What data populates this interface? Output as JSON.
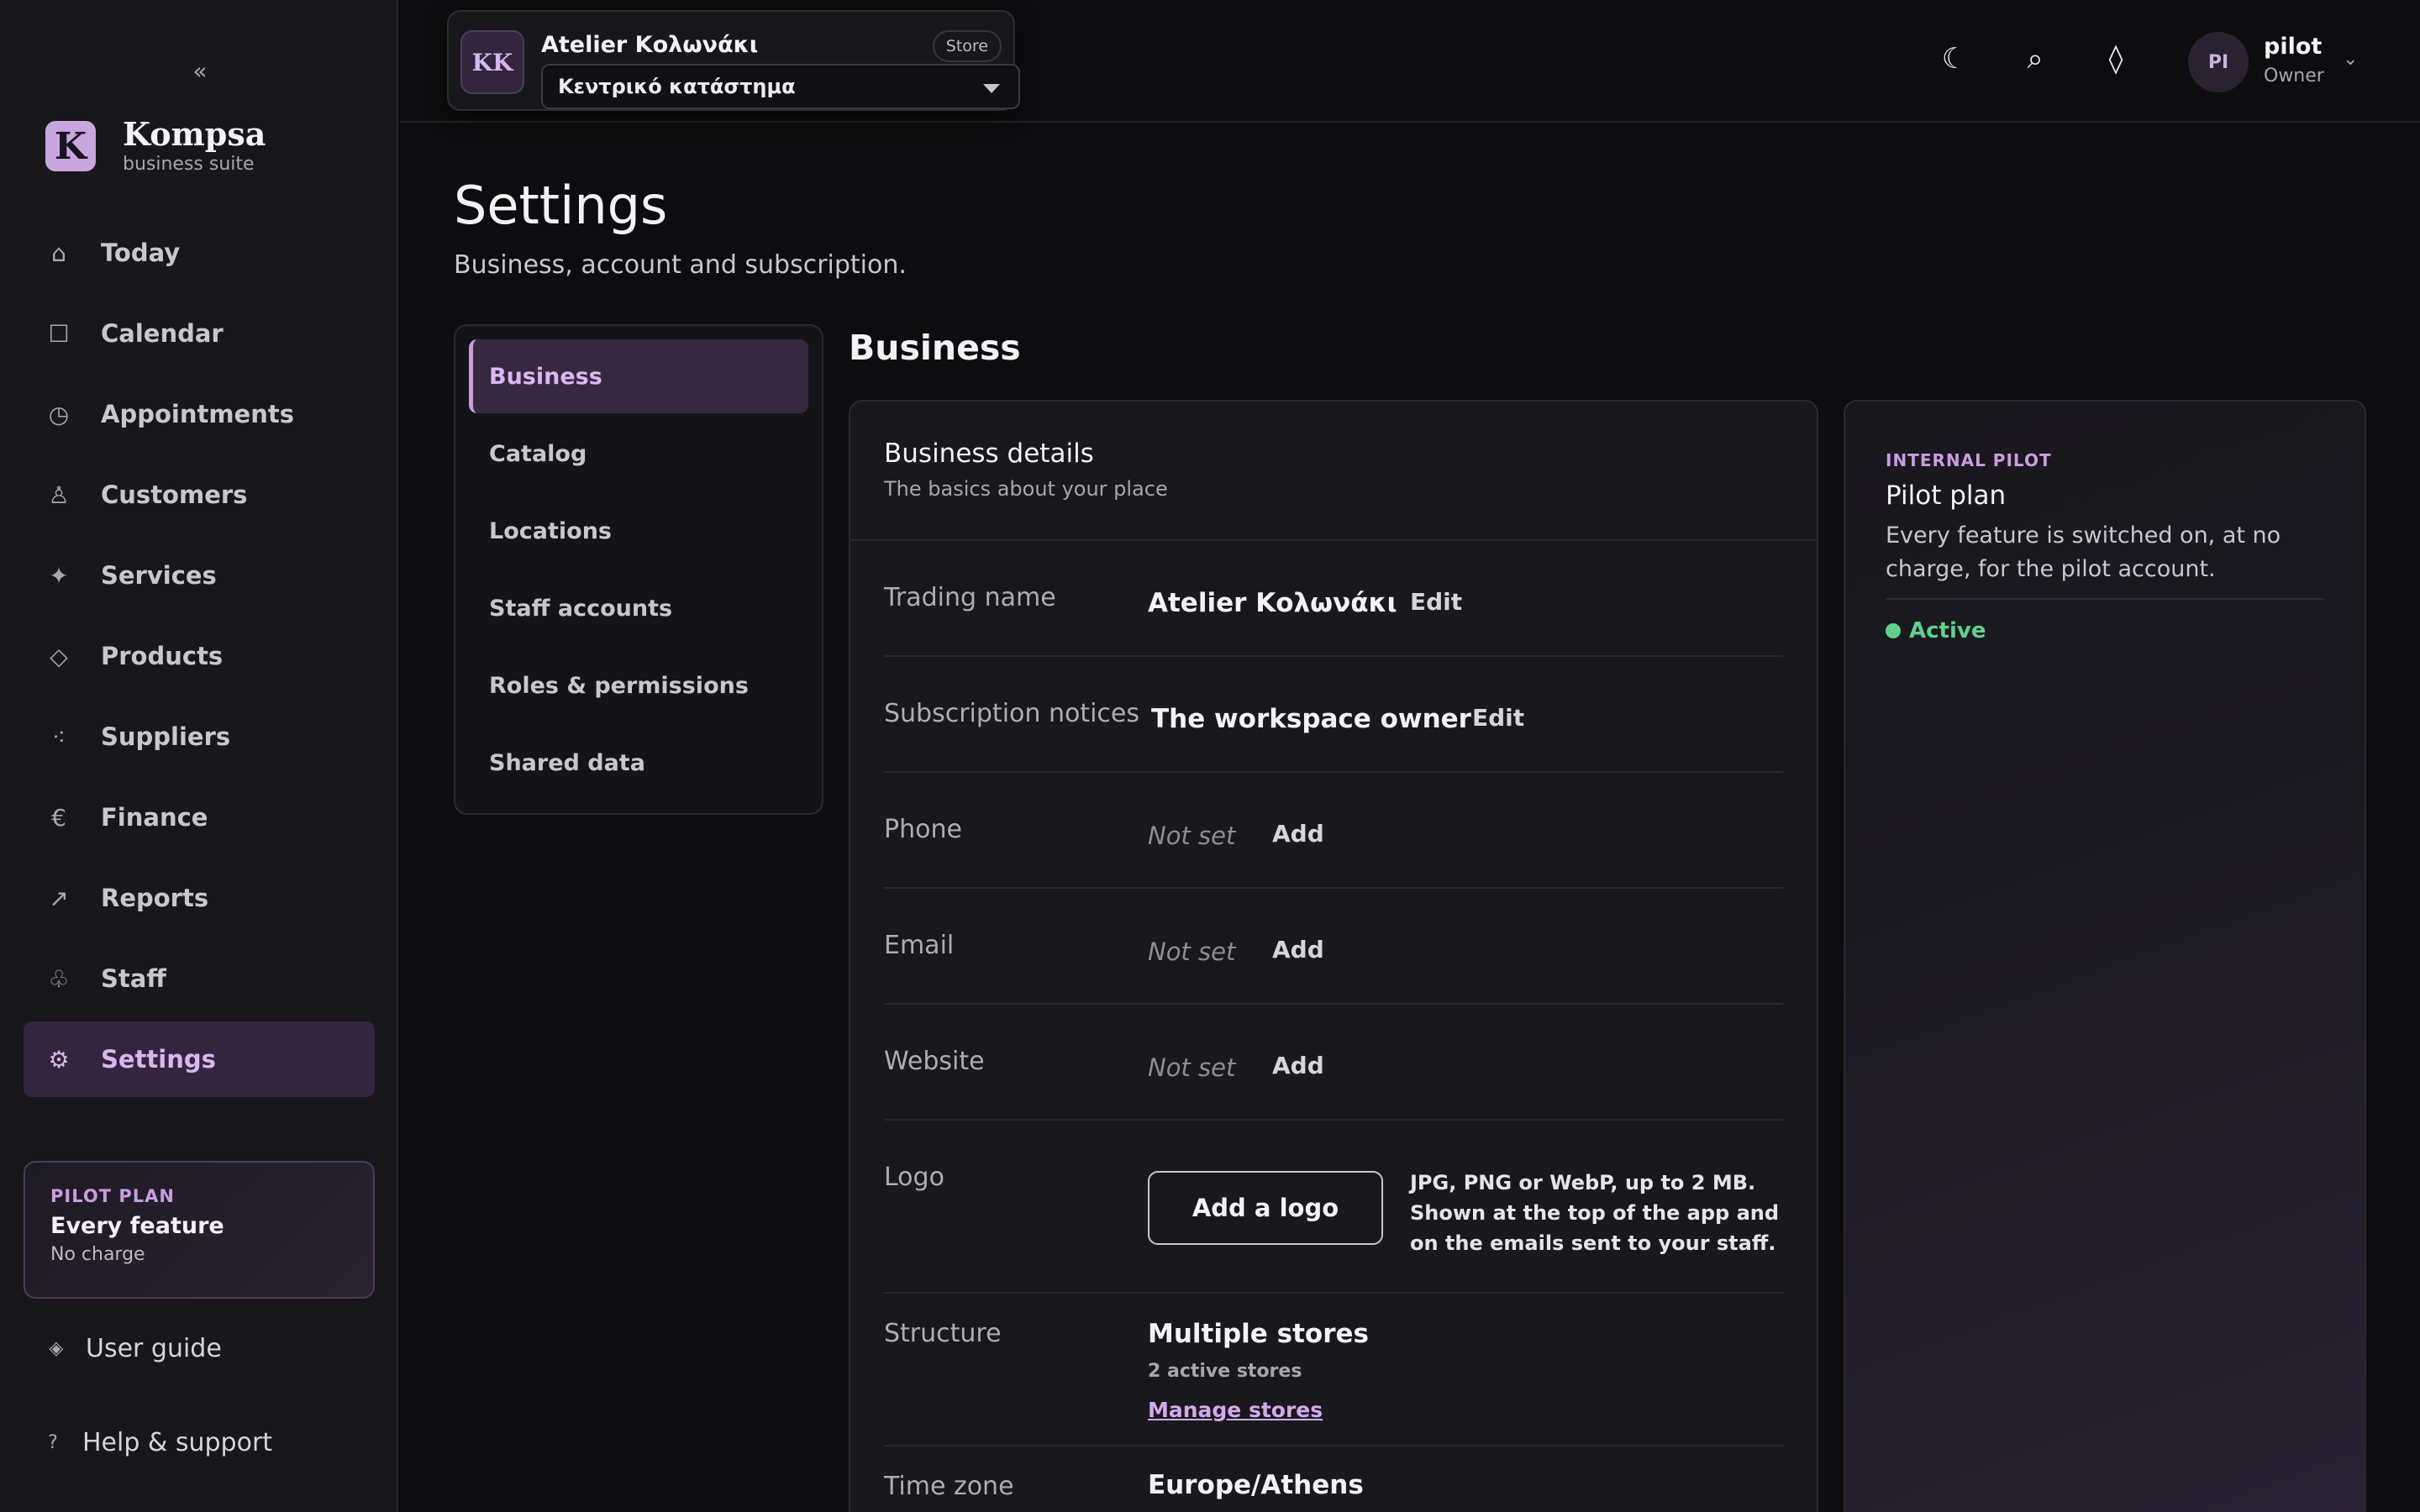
{
  "sidebar": {
    "collapse_icon": "«",
    "brand": {
      "logo": "K",
      "name": "Kompsa",
      "tagline": "business suite"
    },
    "nav": [
      {
        "label": "Today",
        "icon": "⌂",
        "icon_name": "home-icon"
      },
      {
        "label": "Calendar",
        "icon": "☐",
        "icon_name": "calendar-icon"
      },
      {
        "label": "Appointments",
        "icon": "◷",
        "icon_name": "clock-icon"
      },
      {
        "label": "Customers",
        "icon": "♙",
        "icon_name": "person-icon"
      },
      {
        "label": "Services",
        "icon": "✦",
        "icon_name": "sparkle-icon"
      },
      {
        "label": "Products",
        "icon": "◇",
        "icon_name": "diamond-icon"
      },
      {
        "label": "Suppliers",
        "icon": "⁖",
        "icon_name": "dots-icon"
      },
      {
        "label": "Finance",
        "icon": "€",
        "icon_name": "euro-icon"
      },
      {
        "label": "Reports",
        "icon": "↗",
        "icon_name": "trend-icon"
      },
      {
        "label": "Staff",
        "icon": "♧",
        "icon_name": "staff-icon"
      },
      {
        "label": "Settings",
        "icon": "⚙",
        "icon_name": "gear-icon",
        "active": true
      }
    ],
    "plan": {
      "eyebrow": "PILOT PLAN",
      "title": "Every feature",
      "subtitle": "No charge"
    },
    "user_guide": {
      "label": "User guide",
      "icon": "◈"
    },
    "help": {
      "label": "Help & support",
      "icon": "?"
    }
  },
  "topbar": {
    "store": {
      "avatar": "KK",
      "name": "Atelier Κολωνάκι",
      "badge": "Store",
      "selected": "Κεντρικό κατάστημα"
    },
    "icons": {
      "theme": "☾",
      "search": "⌕",
      "diamond": "◊"
    },
    "user": {
      "initials": "PI",
      "name": "pilot",
      "role": "Owner",
      "chevron": "⌄"
    }
  },
  "page": {
    "title": "Settings",
    "subtitle": "Business, account and subscription."
  },
  "subnav": [
    {
      "label": "Business",
      "active": true
    },
    {
      "label": "Catalog"
    },
    {
      "label": "Locations"
    },
    {
      "label": "Staff accounts"
    },
    {
      "label": "Roles & permissions"
    },
    {
      "label": "Shared data"
    }
  ],
  "section": {
    "title": "Business"
  },
  "details": {
    "title": "Business details",
    "subtitle": "The basics about your place",
    "trading_name": {
      "label": "Trading name",
      "value": "Atelier Κολωνάκι",
      "action": "Edit"
    },
    "subscription": {
      "label": "Subscription notices",
      "value": "The workspace owner",
      "action": "Edit"
    },
    "phone": {
      "label": "Phone",
      "value": "Not set",
      "action": "Add"
    },
    "email": {
      "label": "Email",
      "value": "Not set",
      "action": "Add"
    },
    "website": {
      "label": "Website",
      "value": "Not set",
      "action": "Add"
    },
    "logo": {
      "label": "Logo",
      "button": "Add a logo",
      "help": "JPG, PNG or WebP, up to 2 MB. Shown at the top of the app and on the emails sent to your staff."
    },
    "structure": {
      "label": "Structure",
      "value": "Multiple stores",
      "sub": "2 active stores",
      "link": "Manage stores"
    },
    "timezone": {
      "label": "Time zone",
      "value": "Europe/Athens"
    }
  },
  "plan_card": {
    "eyebrow": "INTERNAL PILOT",
    "title": "Pilot plan",
    "description": "Every feature is switched on, at no charge, for the pilot account.",
    "status": "Active",
    "status_color": "#5fd08f"
  },
  "colors": {
    "accent": "#c99de0",
    "background": "#0d0d0f",
    "sidebar": "#18171c"
  }
}
